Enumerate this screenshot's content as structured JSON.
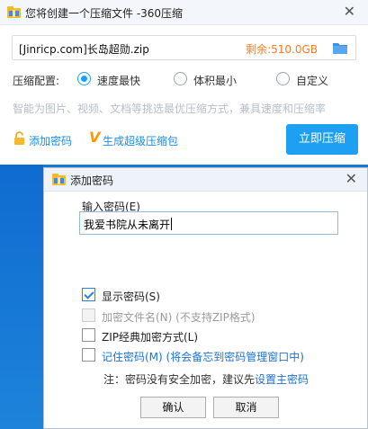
{
  "main_window": {
    "title": "您将创建一个压缩文件 -360压缩",
    "close_glyph": "✕",
    "file_name": "[Jinricp.com]长岛超勋.zip",
    "remaining": "剩余:510.0GB",
    "options_label": "压缩配置:",
    "options": [
      {
        "label": "速度最快",
        "selected": true
      },
      {
        "label": "体积最小",
        "selected": false
      },
      {
        "label": "自定义",
        "selected": false
      }
    ],
    "hint": "智能为图片、视频、文档等挑选最优压缩方式，兼具速度和压缩率",
    "add_password": "添加密码",
    "v_badge": "V",
    "super_package": "生成超级压缩包",
    "compress_button": "立即压缩"
  },
  "password_dialog": {
    "title": "添加密码",
    "close_glyph": "✕",
    "input_label": "输入密码(E)",
    "password_value": "我爱书院从未离开",
    "checkboxes": [
      {
        "label": "显示密码(S)",
        "checked": true,
        "disabled": false
      },
      {
        "label": "加密文件名(N) (不支持ZIP格式)",
        "checked": false,
        "disabled": true
      },
      {
        "label": "ZIP经典加密方式(L)",
        "checked": false,
        "disabled": false
      },
      {
        "label": "记住密码(M) (将会备忘到密码管理窗口中)",
        "checked": false,
        "disabled": false
      }
    ],
    "note_prefix": "注：密码没有安全加密，建议先",
    "note_link": "设置主密码",
    "ok_button": "确认",
    "cancel_button": "取消"
  },
  "colors": {
    "accent_blue": "#1ea0f2",
    "link_blue": "#1a73d6",
    "remaining_orange": "#ff7a1a",
    "desktop_blue": "#1a78d0"
  },
  "icons": {
    "app": "360-zip-icon",
    "folder": "folder-icon",
    "lock": "lock-icon"
  }
}
